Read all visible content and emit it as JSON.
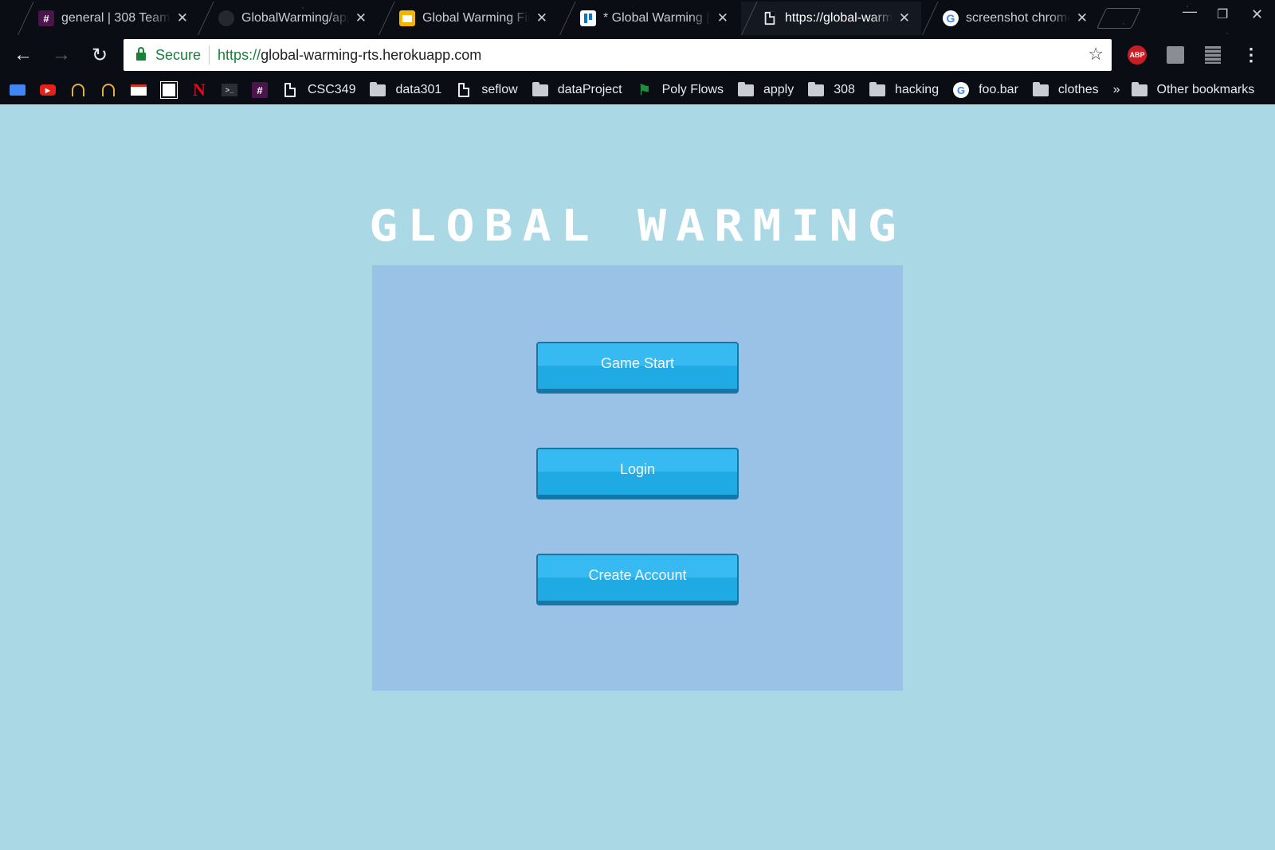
{
  "tabs": [
    {
      "title": "general | 308 Team S",
      "icon": "slack-hash-icon"
    },
    {
      "title": "GlobalWarming/app",
      "icon": "github-icon"
    },
    {
      "title": "Global Warming Fina",
      "icon": "slides-icon"
    },
    {
      "title": "* Global Warming | T",
      "icon": "trello-icon"
    },
    {
      "title": "https://global-warmi",
      "icon": "page-icon",
      "active": true
    },
    {
      "title": "screenshot chromeb",
      "icon": "google-icon"
    }
  ],
  "toolbar": {
    "secure_label": "Secure",
    "url_scheme": "https://",
    "url_host": "global-warming-rts.herokuapp.com"
  },
  "extensions": {
    "adblock_label": "ABP"
  },
  "bookmarks": [
    {
      "label": "",
      "icon": "inbox-icon"
    },
    {
      "label": "",
      "icon": "youtube-icon"
    },
    {
      "label": "",
      "icon": "cal-poly-icon"
    },
    {
      "label": "",
      "icon": "cal-poly-icon"
    },
    {
      "label": "",
      "icon": "gmail-icon"
    },
    {
      "label": "",
      "icon": "usaa-icon"
    },
    {
      "label": "",
      "icon": "netflix-icon"
    },
    {
      "label": "",
      "icon": "terminal-icon"
    },
    {
      "label": "",
      "icon": "slack-hash-icon"
    },
    {
      "label": "CSC349",
      "icon": "page-icon"
    },
    {
      "label": "data301",
      "icon": "folder-icon"
    },
    {
      "label": "seflow",
      "icon": "page-icon"
    },
    {
      "label": "dataProject",
      "icon": "folder-icon"
    },
    {
      "label": "Poly Flows",
      "icon": "flag-icon"
    },
    {
      "label": "apply",
      "icon": "folder-icon"
    },
    {
      "label": "308",
      "icon": "folder-icon"
    },
    {
      "label": "hacking",
      "icon": "folder-icon"
    },
    {
      "label": "foo.bar",
      "icon": "google-icon"
    },
    {
      "label": "clothes",
      "icon": "folder-icon"
    }
  ],
  "bookmarks_overflow": "»",
  "other_bookmarks": "Other bookmarks",
  "game": {
    "title": "GLOBAL WARMING",
    "buttons": {
      "start": "Game Start",
      "login": "Login",
      "create": "Create Account"
    }
  },
  "colors": {
    "page_bg": "#abd8e5",
    "panel_bg": "#9ac2e6",
    "button": "#20aae3",
    "secure_green": "#188038"
  }
}
